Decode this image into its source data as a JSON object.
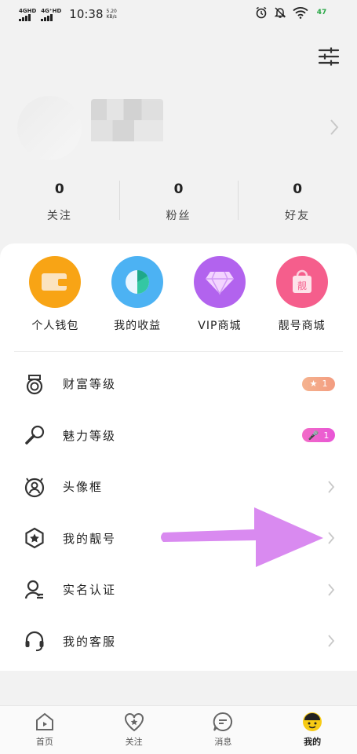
{
  "status_bar": {
    "sim1": "4GHD",
    "sim2": "4G⁺HD",
    "time": "10:38",
    "speed_value": "5.20",
    "speed_unit": "KB/s",
    "battery": "47",
    "icons": [
      "alarm-icon",
      "mute-bell-icon",
      "wifi-icon",
      "battery-icon"
    ]
  },
  "header": {
    "settings_icon": "settings-sliders-icon"
  },
  "stats": [
    {
      "value": "0",
      "label": "关注"
    },
    {
      "value": "0",
      "label": "粉丝"
    },
    {
      "value": "0",
      "label": "好友"
    }
  ],
  "quick_actions": [
    {
      "label": "个人钱包",
      "icon": "wallet-icon",
      "color": "#f8a415"
    },
    {
      "label": "我的收益",
      "icon": "pie-chart-icon",
      "color": "#4cb2f3"
    },
    {
      "label": "VIP商城",
      "icon": "diamond-icon",
      "color": "#b263ee"
    },
    {
      "label": "靓号商城",
      "icon": "shopping-bag-icon",
      "color": "#f55e8c",
      "bag_text": "靓"
    }
  ],
  "menu": [
    {
      "label": "财富等级",
      "icon": "medal-icon",
      "badge": "1"
    },
    {
      "label": "魅力等级",
      "icon": "microphone-icon",
      "badge": "1"
    },
    {
      "label": "头像框",
      "icon": "avatar-frame-icon"
    },
    {
      "label": "我的靓号",
      "icon": "star-hexagon-icon"
    },
    {
      "label": "实名认证",
      "icon": "id-verify-icon"
    },
    {
      "label": "我的客服",
      "icon": "headset-icon"
    }
  ],
  "bottom_nav": [
    {
      "label": "首页",
      "icon": "home-icon"
    },
    {
      "label": "关注",
      "icon": "heart-star-icon"
    },
    {
      "label": "消息",
      "icon": "message-icon"
    },
    {
      "label": "我的",
      "icon": "profile-face-icon",
      "active": true
    }
  ],
  "colors": {
    "accent_arrow": "#d98af0",
    "background": "#f2f2f2"
  }
}
